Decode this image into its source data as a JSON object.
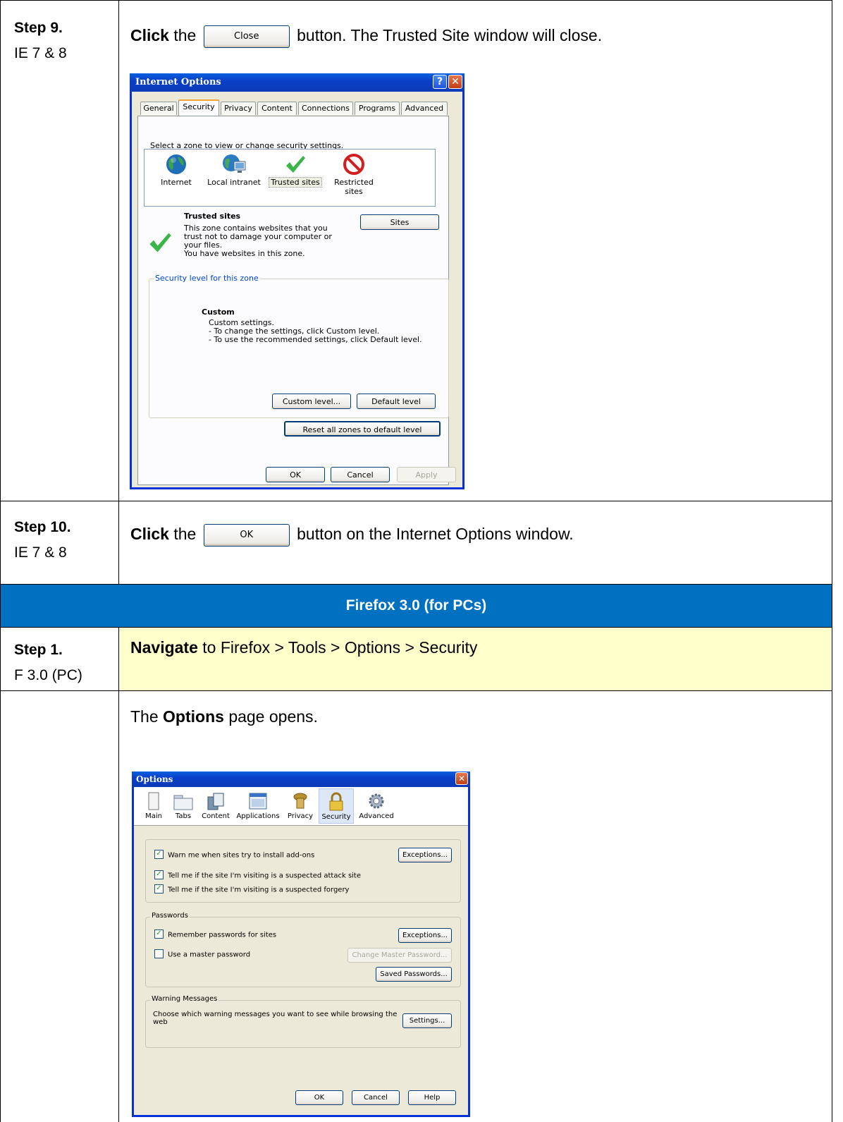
{
  "rows": {
    "step9": {
      "label": "Step 9.",
      "sub": "IE 7 & 8",
      "verb": "Click",
      "pre": "the",
      "button": "Close",
      "post": "button.  The Trusted Site window will close."
    },
    "step10": {
      "label": "Step 10.",
      "sub": "IE 7 & 8",
      "verb": "Click",
      "pre": "the",
      "button": "OK",
      "post": "button on the Internet Options window."
    },
    "section": {
      "title": "Firefox 3.0 (for PCs)",
      "color": "#0070c0"
    },
    "step1": {
      "label": "Step 1.",
      "sub": "F 3.0 (PC)",
      "verb": "Navigate",
      "text": "to Firefox > Tools > Options > Security",
      "color": "#ffffcc"
    },
    "options_note": {
      "pre": "The",
      "bold": "Options",
      "post": "page opens."
    }
  },
  "ie_dialog": {
    "title": "Internet Options",
    "help_btn": "?",
    "close_btn": "✕",
    "tabs": [
      "General",
      "Security",
      "Privacy",
      "Content",
      "Connections",
      "Programs",
      "Advanced"
    ],
    "active_tab": "Security",
    "zone_prompt": "Select a zone to view or change security settings.",
    "zones": [
      {
        "label": "Internet",
        "icon": "globe-icon"
      },
      {
        "label": "Local intranet",
        "icon": "intranet-icon"
      },
      {
        "label": "Trusted sites",
        "icon": "checkmark-icon"
      },
      {
        "label": "Restricted sites",
        "icon": "restricted-icon"
      }
    ],
    "zone_title": "Trusted sites",
    "zone_desc_1": "This zone contains websites that you",
    "zone_desc_2": "trust not to damage your computer or",
    "zone_desc_3": "your files.",
    "zone_desc_4": "You have websites in this zone.",
    "sites_btn": "Sites",
    "level_group": "Security level for this zone",
    "level_title": "Custom",
    "level_1": "Custom settings.",
    "level_2": "- To change the settings, click Custom level.",
    "level_3": "- To use the recommended settings, click Default level.",
    "custom_btn": "Custom level...",
    "default_btn": "Default level",
    "reset_btn": "Reset all zones to default level",
    "ok": "OK",
    "cancel": "Cancel",
    "apply": "Apply"
  },
  "ff_dialog": {
    "title": "Options",
    "close_btn": "✕",
    "panes": [
      {
        "label": "Main",
        "icon": "main-pane-icon"
      },
      {
        "label": "Tabs",
        "icon": "tabs-pane-icon"
      },
      {
        "label": "Content",
        "icon": "content-pane-icon"
      },
      {
        "label": "Applications",
        "icon": "applications-pane-icon"
      },
      {
        "label": "Privacy",
        "icon": "privacy-pane-icon"
      },
      {
        "label": "Security",
        "icon": "security-lock-icon"
      },
      {
        "label": "Advanced",
        "icon": "advanced-gear-icon"
      }
    ],
    "selected_pane": "Security",
    "warn_addons": "Warn me when sites try to install add-ons",
    "exceptions": "Exceptions...",
    "attack_site": "Tell me if the site I'm visiting is a suspected attack site",
    "forgery": "Tell me if the site I'm visiting is a suspected forgery",
    "passwords_group": "Passwords",
    "remember": "Remember passwords for sites",
    "master": "Use a master password",
    "change_master": "Change Master Password...",
    "saved_passwords": "Saved Passwords...",
    "warning_group": "Warning Messages",
    "warning_text_1": "Choose which warning messages you want to see while browsing the",
    "warning_text_2": "web",
    "settings": "Settings...",
    "ok": "OK",
    "cancel": "Cancel",
    "help": "Help",
    "checked": "✓"
  }
}
